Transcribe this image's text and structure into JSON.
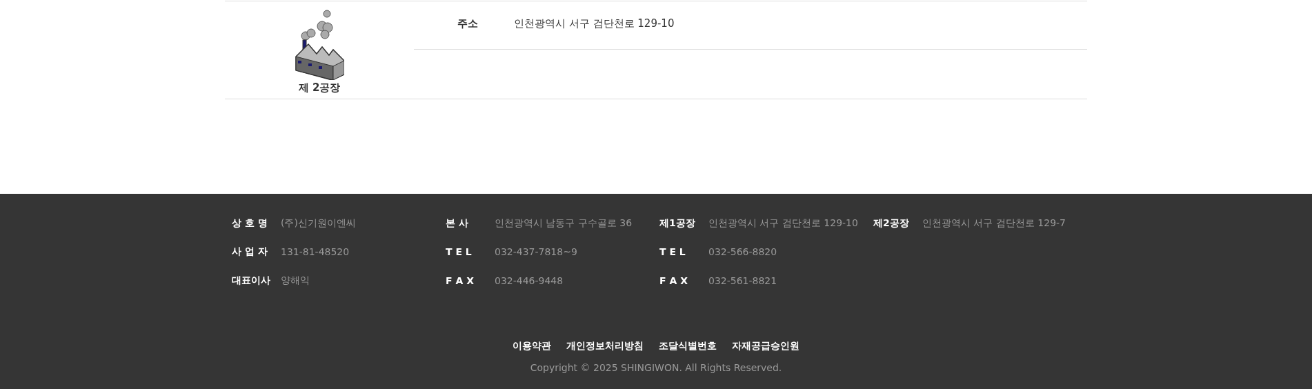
{
  "plant": {
    "name": "제 2공장",
    "rows": [
      {
        "label": "주소",
        "value": "인천광역시 서구 검단천로 129-10"
      },
      {
        "label": "",
        "value": ""
      }
    ]
  },
  "footer": {
    "columns": [
      [
        {
          "label": "상 호 명",
          "value": "(주)신기원이엔씨"
        },
        {
          "label": "사 업 자",
          "value": "131-81-48520"
        },
        {
          "label": "대표이사",
          "value": "양해익"
        }
      ],
      [
        {
          "label": "본 사",
          "value": "인천광역시 남동구 구수골로 36"
        },
        {
          "label": "T E L",
          "value": "032-437-7818~9"
        },
        {
          "label": "F A X",
          "value": "032-446-9448"
        }
      ],
      [
        {
          "label": "제1공장",
          "value": "인천광역시 서구 검단천로 129-10"
        },
        {
          "label": "T E L",
          "value": "032-566-8820"
        },
        {
          "label": "F A X",
          "value": "032-561-8821"
        }
      ],
      [
        {
          "label": "제2공장",
          "value": "인천광역시 서구 검단천로 129-7"
        }
      ]
    ],
    "links": [
      "이용약관",
      "개인정보처리방침",
      "조달식별번호",
      "자재공급승인원"
    ],
    "copyright": "Copyright © 2025 SHINGIWON. All Rights Reserved."
  }
}
